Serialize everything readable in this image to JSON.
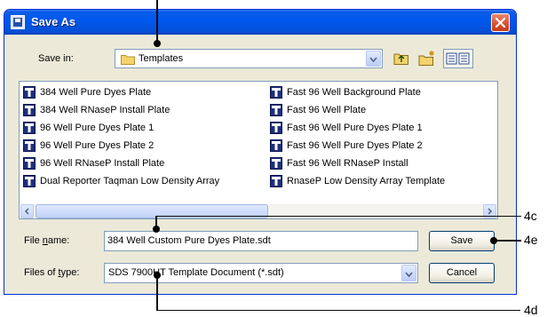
{
  "window": {
    "title": "Save As",
    "title_icon": "save-dialog-icon",
    "close_icon": "close-x-icon"
  },
  "save_in": {
    "label": "Save in:",
    "value": "Templates",
    "folder_icon": "folder-icon"
  },
  "toolbar": {
    "up_icon": "up-one-level-icon",
    "new_folder_icon": "new-folder-icon",
    "view_icon": "view-menu-icon"
  },
  "files": [
    "384 Well Pure Dyes Plate",
    "384 Well RNaseP Install Plate",
    "96 Well Pure Dyes Plate 1",
    "96 Well Pure Dyes Plate 2",
    "96 Well RNaseP Install Plate",
    "Dual Reporter Taqman Low Density Array",
    "Fast 96 Well Background Plate",
    "Fast 96 Well Plate",
    "Fast 96 Well Pure Dyes Plate 1",
    "Fast 96 Well Pure Dyes Plate 2",
    "Fast 96 Well RNaseP Install",
    "RnaseP Low Density Array Template"
  ],
  "file_name": {
    "label": "File name:",
    "value": "384 Well Custom Pure Dyes Plate.sdt"
  },
  "file_type": {
    "label": "Files of type:",
    "value": "SDS 7900HT Template Document (*.sdt)"
  },
  "buttons": {
    "save": "Save",
    "cancel": "Cancel"
  },
  "callouts": {
    "c": "4c",
    "d": "4d",
    "e": "4e"
  }
}
